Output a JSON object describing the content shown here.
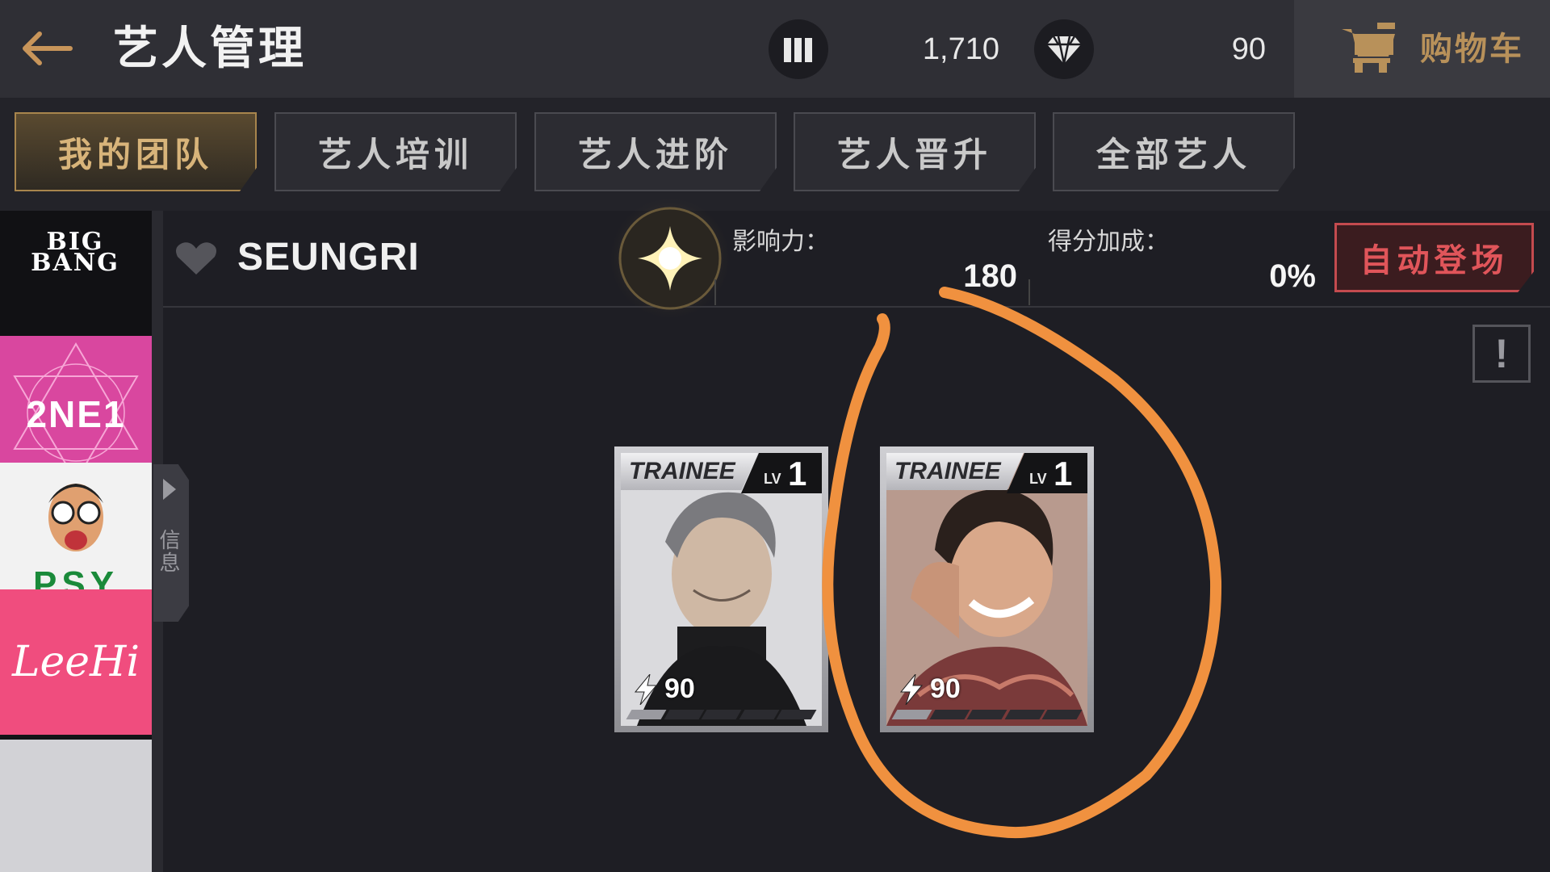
{
  "header": {
    "title": "艺人管理",
    "currency1_value": "1,710",
    "currency2_value": "90",
    "shop_label": "购物车"
  },
  "tabs": [
    {
      "label": "我的团队",
      "active": true
    },
    {
      "label": "艺人培训",
      "active": false
    },
    {
      "label": "艺人进阶",
      "active": false
    },
    {
      "label": "艺人晋升",
      "active": false
    },
    {
      "label": "全部艺人",
      "active": false
    }
  ],
  "groups": [
    {
      "label": "BIG BANG",
      "colors": {
        "bg": "#111114",
        "fg": "#ffffff"
      }
    },
    {
      "label": "2NE1",
      "colors": {
        "bg": "#d9479f",
        "fg": "#ffffff"
      }
    },
    {
      "label": "PSY",
      "colors": {
        "bg": "#f2f2f2",
        "fg": "#1a8a3a"
      }
    },
    {
      "label": "LeeHi",
      "colors": {
        "bg": "#f04d7e",
        "fg": "#ffffff"
      }
    }
  ],
  "drawer": {
    "label": "信息"
  },
  "artist": {
    "name": "SEUNGRI",
    "influence_label": "影响力：",
    "influence_value": "180",
    "score_bonus_label": "得分加成：",
    "score_bonus_value": "0%",
    "auto_button": "自动登场"
  },
  "cards": [
    {
      "tag": "TRAINEE",
      "lv_label": "LV",
      "level": "1",
      "power": "90",
      "bar_filled_segments": 1,
      "bar_total_segments": 5
    },
    {
      "tag": "TRAINEE",
      "lv_label": "LV",
      "level": "1",
      "power": "90",
      "bar_filled_segments": 1,
      "bar_total_segments": 5
    }
  ],
  "colors": {
    "accent_gold": "#b8915a",
    "danger_red": "#e0555a",
    "annotation_orange": "#f0913f"
  },
  "icons": {
    "back": "arrow-left-icon",
    "currency1": "bars-icon",
    "currency2": "diamond-icon",
    "shop": "cart-icon",
    "heart": "heart-icon",
    "influence": "star-glow-icon",
    "info": "exclamation-icon",
    "power": "lightning-icon"
  }
}
